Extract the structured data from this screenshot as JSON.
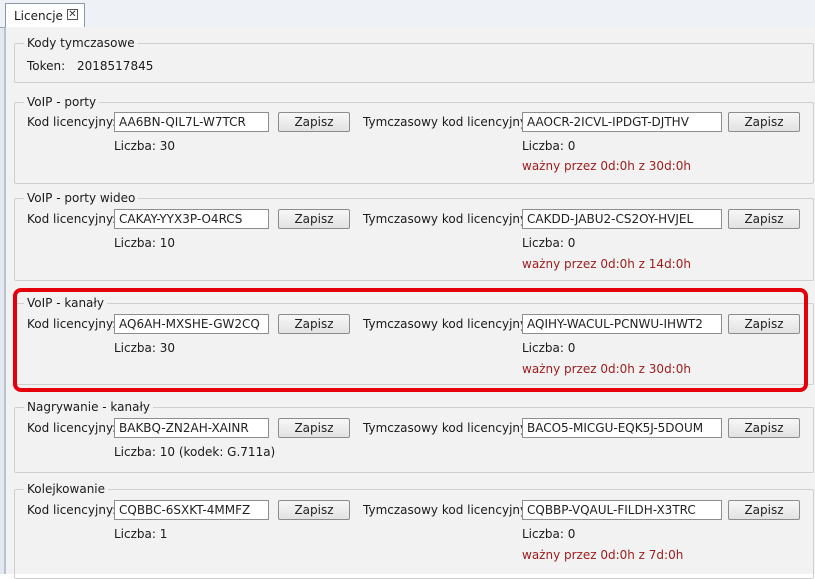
{
  "tab": {
    "label": "Licencje",
    "close_glyph": "✕"
  },
  "common": {
    "license_label": "Kod licencyjny:",
    "temp_license_label": "Tymczasowy kod licencyjny:",
    "save_label": "Zapisz"
  },
  "temp_codes": {
    "title": "Kody tymczasowe",
    "token_label": "Token:",
    "token_value": "2018517845"
  },
  "voip_ports": {
    "title": "VoIP - porty",
    "code": "AA6BN-QIL7L-W7TCR",
    "count": "Liczba: 30",
    "temp_code": "AAOCR-2ICVL-IPDGT-DJTHV",
    "temp_count": "Liczba: 0",
    "valid": "ważny przez 0d:0h z 30d:0h"
  },
  "voip_video": {
    "title": "VoIP - porty wideo",
    "code": "CAKAY-YYX3P-O4RCS",
    "count": "Liczba: 10",
    "temp_code": "CAKDD-JABU2-CS2OY-HVJEL",
    "temp_count": "Liczba: 0",
    "valid": "ważny przez 0d:0h z 14d:0h"
  },
  "voip_channels": {
    "title": "VoIP - kanały",
    "code": "AQ6AH-MXSHE-GW2CQ",
    "count": "Liczba: 30",
    "temp_code": "AQIHY-WACUL-PCNWU-IHWT2",
    "temp_count": "Liczba: 0",
    "valid": "ważny przez 0d:0h z 30d:0h"
  },
  "recording": {
    "title": "Nagrywanie - kanały",
    "code": "BAKBQ-ZN2AH-XAINR",
    "count": "Liczba: 10 (kodek: G.711a)",
    "temp_code": "BACO5-MICGU-EQK5J-5DOUM"
  },
  "queueing": {
    "title": "Kolejkowanie",
    "code": "CQBBC-6SXKT-4MMFZ",
    "count": "Liczba: 1",
    "temp_code": "CQBBP-VQAUL-FILDH-X3TRC",
    "temp_count": "Liczba: 0",
    "valid": "ważny przez 0d:0h z 7d:0h"
  },
  "colors": {
    "highlight": "#e3000b",
    "valid_text": "#9c1b1b"
  }
}
